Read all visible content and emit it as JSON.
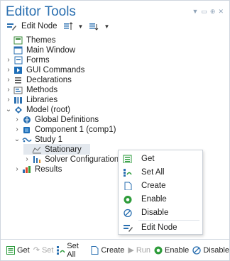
{
  "window": {
    "title": "Editor Tools"
  },
  "toolbar": {
    "edit_node_label": "Edit Node"
  },
  "tree": [
    {
      "label": "Themes",
      "icon": "themes-icon"
    },
    {
      "label": "Main Window",
      "icon": "main-window-icon"
    },
    {
      "label": "Forms",
      "icon": "forms-icon"
    },
    {
      "label": "GUI Commands",
      "icon": "gui-commands-icon"
    },
    {
      "label": "Declarations",
      "icon": "declarations-icon"
    },
    {
      "label": "Methods",
      "icon": "methods-icon"
    },
    {
      "label": "Libraries",
      "icon": "libraries-icon"
    },
    {
      "label": "Model (root)",
      "icon": "model-icon"
    },
    {
      "label": "Global Definitions",
      "icon": "global-definitions-icon"
    },
    {
      "label": "Component 1 (comp1)",
      "icon": "component-icon"
    },
    {
      "label": "Study 1",
      "icon": "study-icon"
    },
    {
      "label": "Stationary",
      "icon": "stationary-icon"
    },
    {
      "label": "Solver Configurations",
      "icon": "solver-configurations-icon"
    },
    {
      "label": "Results",
      "icon": "results-icon"
    }
  ],
  "context_menu": {
    "items": [
      {
        "label": "Get",
        "icon": "get-icon"
      },
      {
        "label": "Set All",
        "icon": "set-all-icon"
      },
      {
        "label": "Create",
        "icon": "create-icon"
      },
      {
        "label": "Enable",
        "icon": "enable-icon"
      },
      {
        "label": "Disable",
        "icon": "disable-icon"
      },
      {
        "label": "Edit Node",
        "icon": "edit-node-icon"
      }
    ]
  },
  "bottom_bar": {
    "get": "Get",
    "set": "Set",
    "set_all": "Set All",
    "create": "Create",
    "run": "Run",
    "enable": "Enable",
    "disable": "Disable"
  },
  "colors": {
    "title": "#2a6fb0",
    "accent_green": "#2e9c3a",
    "accent_blue": "#2a6fb0"
  }
}
